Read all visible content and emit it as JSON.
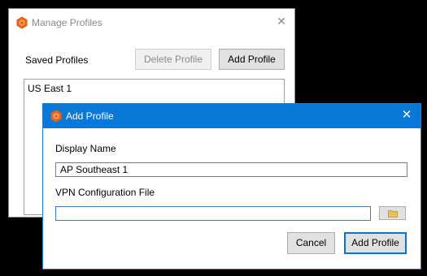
{
  "colors": {
    "accent": "#0A78D7",
    "icon_orange": "#E8631A",
    "disabled_text": "#8A8A8A",
    "backdrop": "#000000"
  },
  "manage_profiles": {
    "title": "Manage Profiles",
    "saved_profiles_label": "Saved Profiles",
    "delete_button": "Delete Profile",
    "add_button": "Add Profile",
    "profiles": [
      "US East 1"
    ],
    "close_icon": "close-icon",
    "app_icon": "hexagon-app-icon"
  },
  "add_profile": {
    "title": "Add Profile",
    "display_name_label": "Display Name",
    "display_name_value": "AP Southeast 1",
    "vpn_config_label": "VPN Configuration File",
    "vpn_config_value": "",
    "browse_icon": "folder-icon",
    "cancel_button": "Cancel",
    "add_button": "Add Profile",
    "close_icon": "close-icon",
    "app_icon": "hexagon-app-icon"
  }
}
